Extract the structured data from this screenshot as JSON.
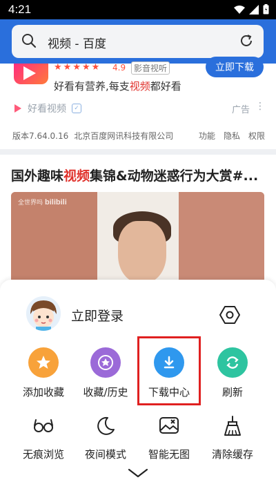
{
  "status_bar": {
    "time": "4:21"
  },
  "search": {
    "query": "视频 - 百度"
  },
  "ad": {
    "rating": "4.9",
    "tag": "影音视听",
    "button_label": "立即下载",
    "slogan_prefix": "好看有营养,每支",
    "slogan_highlight": "视频",
    "slogan_suffix": "都好看",
    "source_name": "好看视频",
    "ad_label": "广告",
    "more": "⋮",
    "version": "版本7.64.0.16",
    "company": "北京百度网讯科技有限公司",
    "links": [
      "功能",
      "隐私",
      "权限"
    ]
  },
  "article": {
    "title_prefix": "国外趣味",
    "title_highlight": "视频",
    "title_suffix": "集锦&动物迷惑行为大赏#...",
    "watermark_site": "全世界吗",
    "watermark_logo": "bilibili"
  },
  "menu": {
    "login": "立即登录",
    "row1": [
      {
        "label": "添加收藏",
        "icon": "star-icon",
        "color": "#f8a23a"
      },
      {
        "label": "收藏/历史",
        "icon": "star-history-icon",
        "color": "#9b6ad8"
      },
      {
        "label": "下载中心",
        "icon": "download-icon",
        "color": "#2f98ee"
      },
      {
        "label": "刷新",
        "icon": "refresh-icon",
        "color": "#2ec4a0"
      }
    ],
    "row2": [
      {
        "label": "无痕浏览",
        "icon": "incognito-glasses-icon"
      },
      {
        "label": "夜间模式",
        "icon": "moon-icon"
      },
      {
        "label": "智能无图",
        "icon": "no-image-icon"
      },
      {
        "label": "清除缓存",
        "icon": "broom-icon"
      }
    ]
  }
}
